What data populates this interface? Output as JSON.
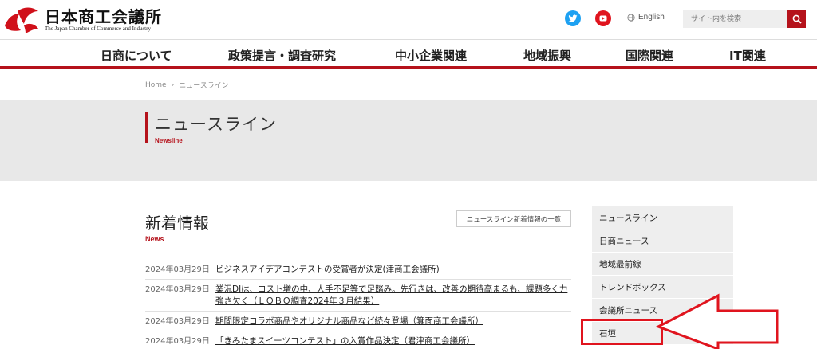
{
  "header": {
    "logo_jp": "日本商工会議所",
    "logo_en": "The Japan Chamber of Commerce and Industry",
    "lang_label": "English",
    "search_placeholder": "サイト内を検索"
  },
  "nav": {
    "items": [
      "日商について",
      "政策提言・調査研究",
      "中小企業関連",
      "地域振興",
      "国際関連",
      "IT関連"
    ]
  },
  "breadcrumb": {
    "home": "Home",
    "separator": "›",
    "current": "ニュースライン"
  },
  "page": {
    "title": "ニュースライン",
    "subtitle": "Newsline"
  },
  "news": {
    "heading": "新着情報",
    "subheading": "News",
    "all_link": "ニュースライン新着情報の一覧",
    "items": [
      {
        "date": "2024年03月29日",
        "title": "ビジネスアイデアコンテストの受賞者が決定(津商工会議所)"
      },
      {
        "date": "2024年03月29日",
        "title": "業況DIは、コスト増の中、人手不足等で足踏み。先行きは、改善の期待高まるも、課題多く力強さ欠く（ＬＯＢＯ調査2024年３月結果）"
      },
      {
        "date": "2024年03月29日",
        "title": "期間限定コラボ商品やオリジナル商品など続々登場（箕面商工会議所）"
      },
      {
        "date": "2024年03月29日",
        "title": "「きみたまスイーツコンテスト」の入賞作品決定（君津商工会議所）"
      }
    ]
  },
  "side_menu": {
    "items": [
      "ニュースライン",
      "日商ニュース",
      "地域最前線",
      "トレンドボックス",
      "会議所ニュース",
      "石垣"
    ]
  },
  "colors": {
    "brand_red": "#b5121b",
    "twitter_blue": "#1da1f2",
    "youtube_red": "#e0141e",
    "annotation_red": "#e0141e"
  },
  "icons": [
    "jcci-logo-icon",
    "twitter-icon",
    "youtube-icon",
    "globe-icon",
    "search-icon",
    "annotation-arrow-icon"
  ]
}
